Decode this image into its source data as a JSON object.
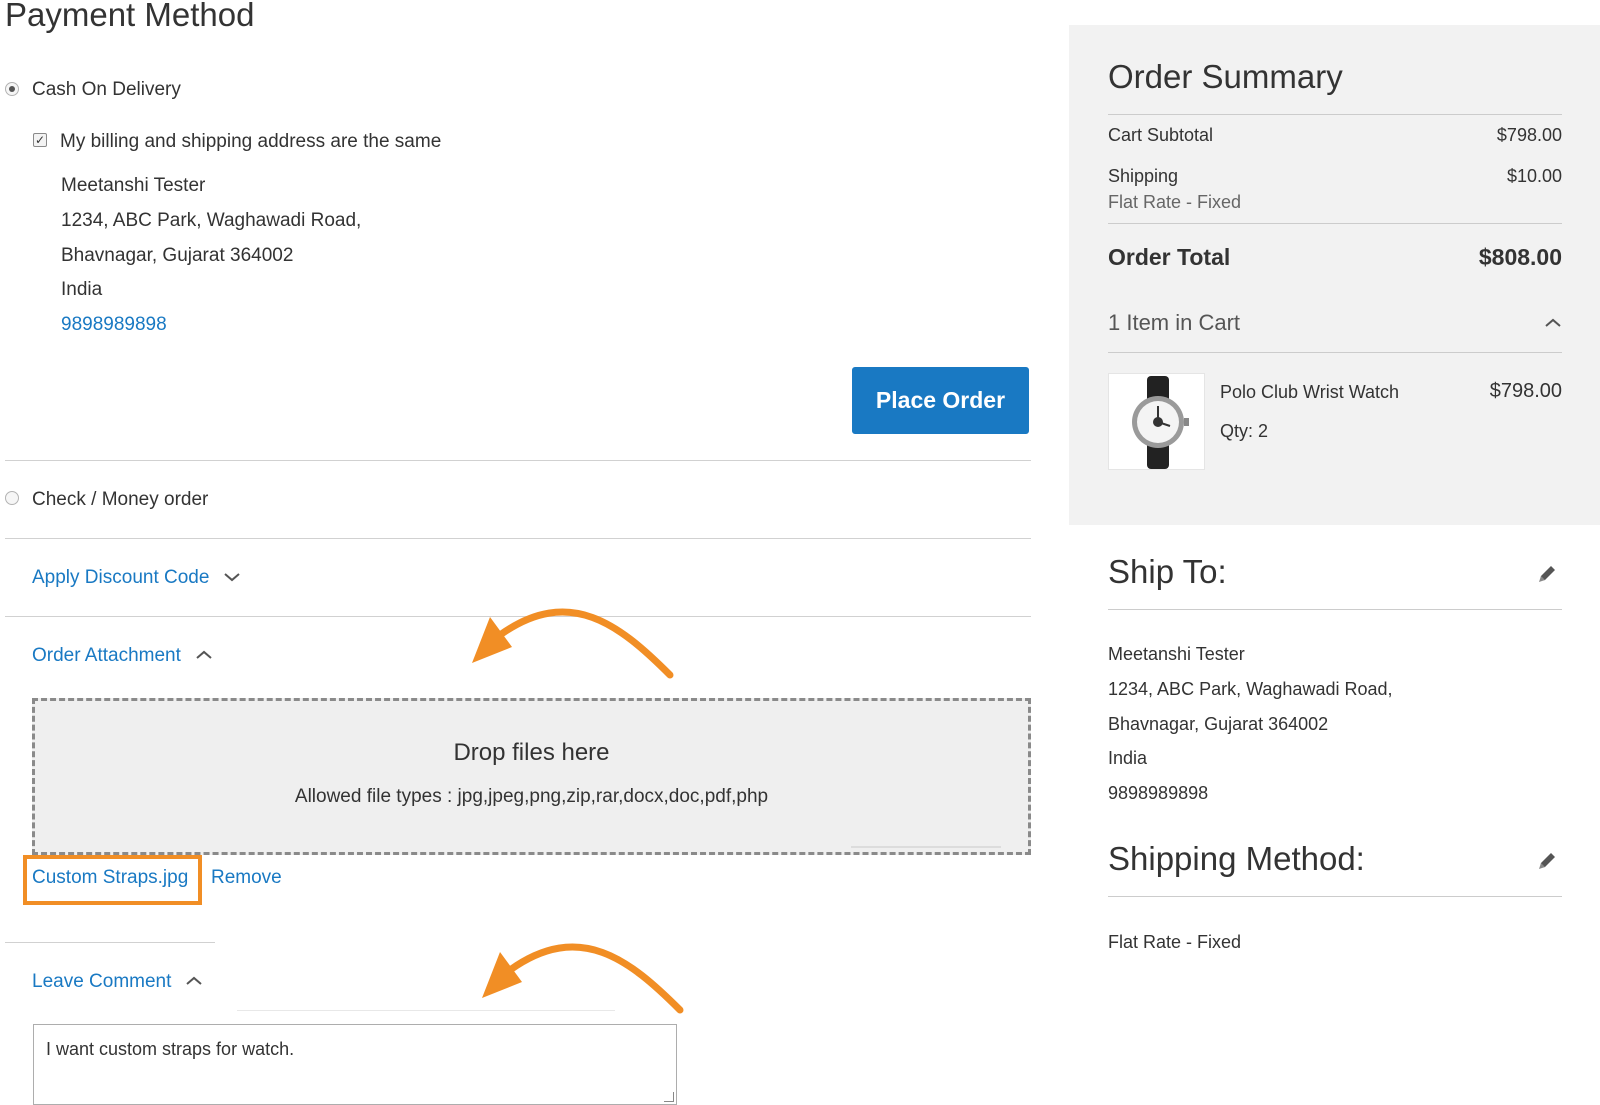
{
  "payment": {
    "title": "Payment Method",
    "methods": [
      {
        "label": "Cash On Delivery",
        "selected": true
      },
      {
        "label": "Check / Money order",
        "selected": false
      }
    ],
    "same_address_label": "My billing and shipping address are the same",
    "same_address_checked": true,
    "address": {
      "name": "Meetanshi Tester",
      "street": "1234, ABC Park, Waghawadi Road,",
      "city": "Bhavnagar, Gujarat 364002",
      "country": "India",
      "phone": "9898989898"
    },
    "place_order_label": "Place Order"
  },
  "discount": {
    "label": "Apply Discount Code",
    "icon": "chevron-down-icon"
  },
  "attachment": {
    "label": "Order Attachment",
    "icon": "chevron-up-icon",
    "drop_title": "Drop files here",
    "allowed_types": "Allowed file types : jpg,jpeg,png,zip,rar,docx,doc,pdf,php",
    "file_name": "Custom Straps.jpg",
    "remove_label": "Remove"
  },
  "comment": {
    "label": "Leave Comment",
    "icon": "chevron-up-icon",
    "value": "I want custom straps for watch."
  },
  "summary": {
    "title": "Order Summary",
    "subtotal_label": "Cart Subtotal",
    "subtotal_value": "$798.00",
    "shipping_label": "Shipping",
    "shipping_method": "Flat Rate - Fixed",
    "shipping_value": "$10.00",
    "total_label": "Order Total",
    "total_value": "$808.00",
    "items_in_cart": "1 Item in Cart",
    "item": {
      "name": "Polo Club Wrist Watch",
      "qty": "Qty: 2",
      "price": "$798.00"
    }
  },
  "ship_to": {
    "title": "Ship To:",
    "name": "Meetanshi Tester",
    "street": "1234, ABC Park, Waghawadi Road,",
    "city": "Bhavnagar, Gujarat 364002",
    "country": "India",
    "phone": "9898989898"
  },
  "shipping_method": {
    "title": "Shipping Method:",
    "value": "Flat Rate - Fixed"
  },
  "colors": {
    "link": "#1979c3",
    "button": "#1979c3",
    "annotation": "#f18e25",
    "panel": "#f2f2f2"
  }
}
